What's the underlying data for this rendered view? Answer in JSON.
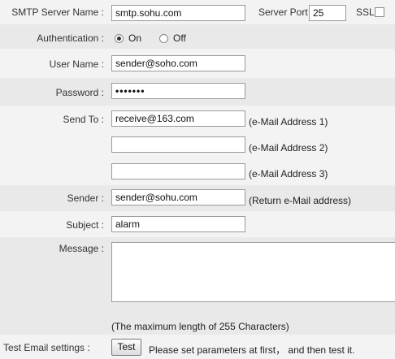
{
  "smtp": {
    "server_label": "SMTP Server Name :",
    "server_value": "smtp.sohu.com",
    "port_label": "Server Port",
    "port_value": "25",
    "ssl_label": "SSL"
  },
  "auth": {
    "label": "Authentication :",
    "on_label": "On",
    "off_label": "Off",
    "selected": "On"
  },
  "user": {
    "label": "User Name :",
    "value": "sender@soho.com"
  },
  "password": {
    "label": "Password :",
    "value": "•••••••"
  },
  "send_to": {
    "label": "Send To :",
    "addr1_value": "receive@163.com",
    "addr1_note": "(e-Mail Address 1)",
    "addr2_value": "",
    "addr2_note": "(e-Mail Address 2)",
    "addr3_value": "",
    "addr3_note": "(e-Mail Address 3)"
  },
  "sender": {
    "label": "Sender :",
    "value": "sender@sohu.com",
    "note": "(Return e-Mail address)"
  },
  "subject": {
    "label": "Subject :",
    "value": "alarm"
  },
  "message": {
    "label": "Message :",
    "value": "",
    "note": "(The maximum length of 255 Characters)"
  },
  "test": {
    "label": "Test Email settings :",
    "button_label": "Test",
    "hint": "Please set parameters at first， and then test it."
  }
}
